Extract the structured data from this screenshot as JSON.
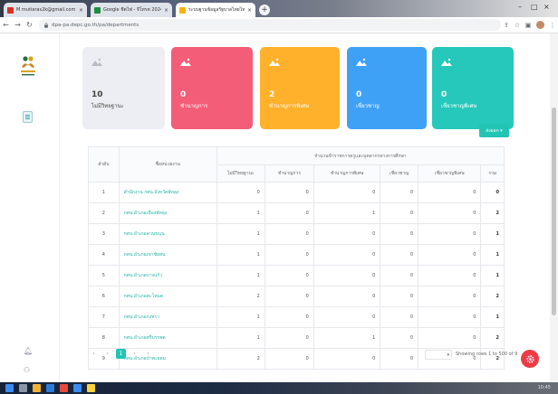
{
  "browser": {
    "tabs": [
      {
        "title": "M mutiaras2k@gmail.com ไม่ได้ถ...",
        "favicon_color": "#d93025"
      },
      {
        "title": "Google ชีตไฟ - จีโทรต 2024",
        "favicon_color": "#1e8e3e"
      },
      {
        "title": "ระบบฐานข้อมูลรัฐบาลไทยไทยไทย",
        "favicon_color": "#f4b400"
      }
    ],
    "url": "dpa-pa.depc.go.th/pa/departments"
  },
  "cards": [
    {
      "value": "10",
      "label": "ไม่มีวิทยฐานะ",
      "color": "#eceef3"
    },
    {
      "value": "0",
      "label": "ชำนาญการ",
      "color": "#f35d78"
    },
    {
      "value": "2",
      "label": "ชำนาญการพิเศษ",
      "color": "#ffb12b"
    },
    {
      "value": "0",
      "label": "เชี่ยวชาญ",
      "color": "#3fa1f6"
    },
    {
      "value": "0",
      "label": "เชี่ยวชาญพิเศษ",
      "color": "#25c8ba"
    }
  ],
  "dropdown_label": "ส่งออก ▾",
  "table": {
    "col_index": "ลำดับ",
    "col_name": "ชื่อหน่วยงาน",
    "group_header": "จำนวนข้าราชการครูและบุคลากรทางการศึกษา",
    "sub_headers": [
      "ไม่มีวิทยฐานะ",
      "ชำนาญการ",
      "ชำนาญการพิเศษ",
      "เชี่ยวชาญ",
      "เชี่ยวชาญพิเศษ",
      "รวม"
    ],
    "rows": [
      {
        "i": "1",
        "name": "สำนักงาน กศน.จังหวัดพัทลุง",
        "v": [
          "0",
          "0",
          "0",
          "0",
          "0",
          "0"
        ]
      },
      {
        "i": "2",
        "name": "กศน.อำเภอเมืองพัทลุง",
        "v": [
          "1",
          "0",
          "1",
          "0",
          "0",
          "2"
        ]
      },
      {
        "i": "3",
        "name": "กศน.อำเภอควนขนุน",
        "v": [
          "1",
          "0",
          "0",
          "0",
          "0",
          "1"
        ]
      },
      {
        "i": "4",
        "name": "กศน.อำเภอเขาชัยสน",
        "v": [
          "1",
          "0",
          "0",
          "0",
          "0",
          "1"
        ]
      },
      {
        "i": "5",
        "name": "กศน.อำเภอบางแก้ว",
        "v": [
          "1",
          "0",
          "0",
          "0",
          "0",
          "1"
        ]
      },
      {
        "i": "6",
        "name": "กศน.อำเภอตะโหมด",
        "v": [
          "2",
          "0",
          "0",
          "0",
          "0",
          "2"
        ]
      },
      {
        "i": "7",
        "name": "กศน.อำเภอกงหรา",
        "v": [
          "1",
          "0",
          "0",
          "0",
          "0",
          "1"
        ]
      },
      {
        "i": "8",
        "name": "กศน.อำเภอศรีบรรพต",
        "v": [
          "1",
          "0",
          "1",
          "0",
          "0",
          "2"
        ]
      },
      {
        "i": "9",
        "name": "กศน.อำเภอป่าพะยอม",
        "v": [
          "2",
          "0",
          "0",
          "0",
          "0",
          "2"
        ]
      }
    ]
  },
  "pagination": {
    "pages": [
      "‹",
      "‹",
      "1",
      "›",
      "›"
    ],
    "showing": "Showing rows 1 to 500 of 9"
  },
  "taskbar": {
    "clock": "10:45"
  }
}
